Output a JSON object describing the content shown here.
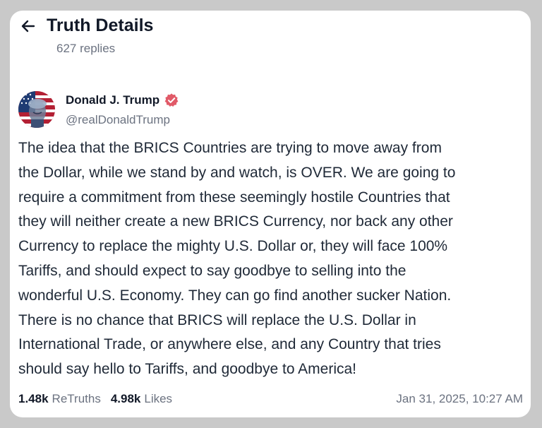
{
  "header": {
    "title": "Truth Details",
    "replies": "627 replies"
  },
  "author": {
    "name": "Donald J. Trump",
    "handle": "@realDonaldTrump",
    "verified": true
  },
  "post": {
    "lines": [
      "The idea that the BRICS Countries are trying to move away from",
      "the Dollar, while we stand by and watch, is OVER. We are going to",
      "require a commitment from these seemingly hostile Countries that",
      "they will neither create a new BRICS Currency, nor back any other",
      "Currency to replace the mighty U.S. Dollar or, they will face 100%",
      "Tariffs, and should expect to say goodbye to selling into the",
      "wonderful U.S. Economy. They can go find another sucker Nation.",
      "There is no chance that BRICS will replace the U.S. Dollar in",
      "International Trade, or anywhere else, and any Country that tries",
      "should say hello to Tariffs, and goodbye to America!"
    ]
  },
  "stats": {
    "retruths_count": "1.48k",
    "retruths_label": "ReTruths",
    "likes_count": "4.98k",
    "likes_label": "Likes",
    "timestamp": "Jan 31, 2025, 10:27 AM"
  },
  "colors": {
    "background": "#c9c9c9",
    "card": "#ffffff",
    "verified_badge": "#e15a68",
    "secondary_text": "#6b7280"
  },
  "icons": {
    "back": "arrow-left-icon",
    "verified": "verified-badge-icon"
  }
}
